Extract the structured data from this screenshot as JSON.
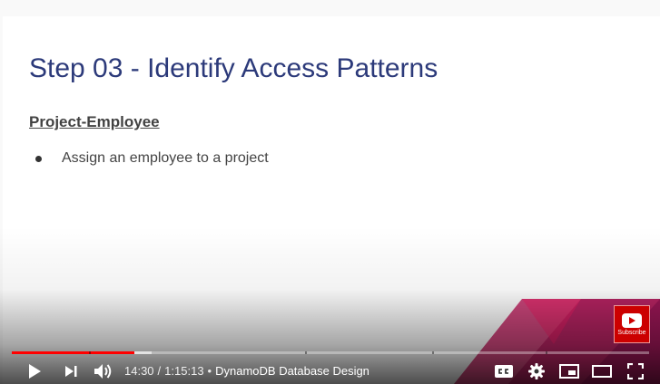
{
  "slide": {
    "title": "Step 03 - Identify Access Patterns",
    "section": "Project-Employee",
    "bullets": [
      "Assign an employee to a project"
    ]
  },
  "subscribe": {
    "label": "Subscribe"
  },
  "player": {
    "current_time": "14:30",
    "time_separator": "/",
    "duration": "1:15:13",
    "chapter_separator": "•",
    "chapter_title": "DynamoDB Database Design",
    "progress_played_fraction": 0.193,
    "progress_buffered_fraction": 0.22,
    "colors": {
      "played": "#ff0000",
      "title": "#2c3a7a",
      "decor": "#c2185b"
    }
  },
  "icons": {
    "play": "play-icon",
    "next": "next-icon",
    "volume": "volume-icon",
    "captions": "captions-icon",
    "settings": "gear-icon",
    "miniplayer": "miniplayer-icon",
    "theater": "theater-icon",
    "fullscreen": "fullscreen-icon"
  }
}
